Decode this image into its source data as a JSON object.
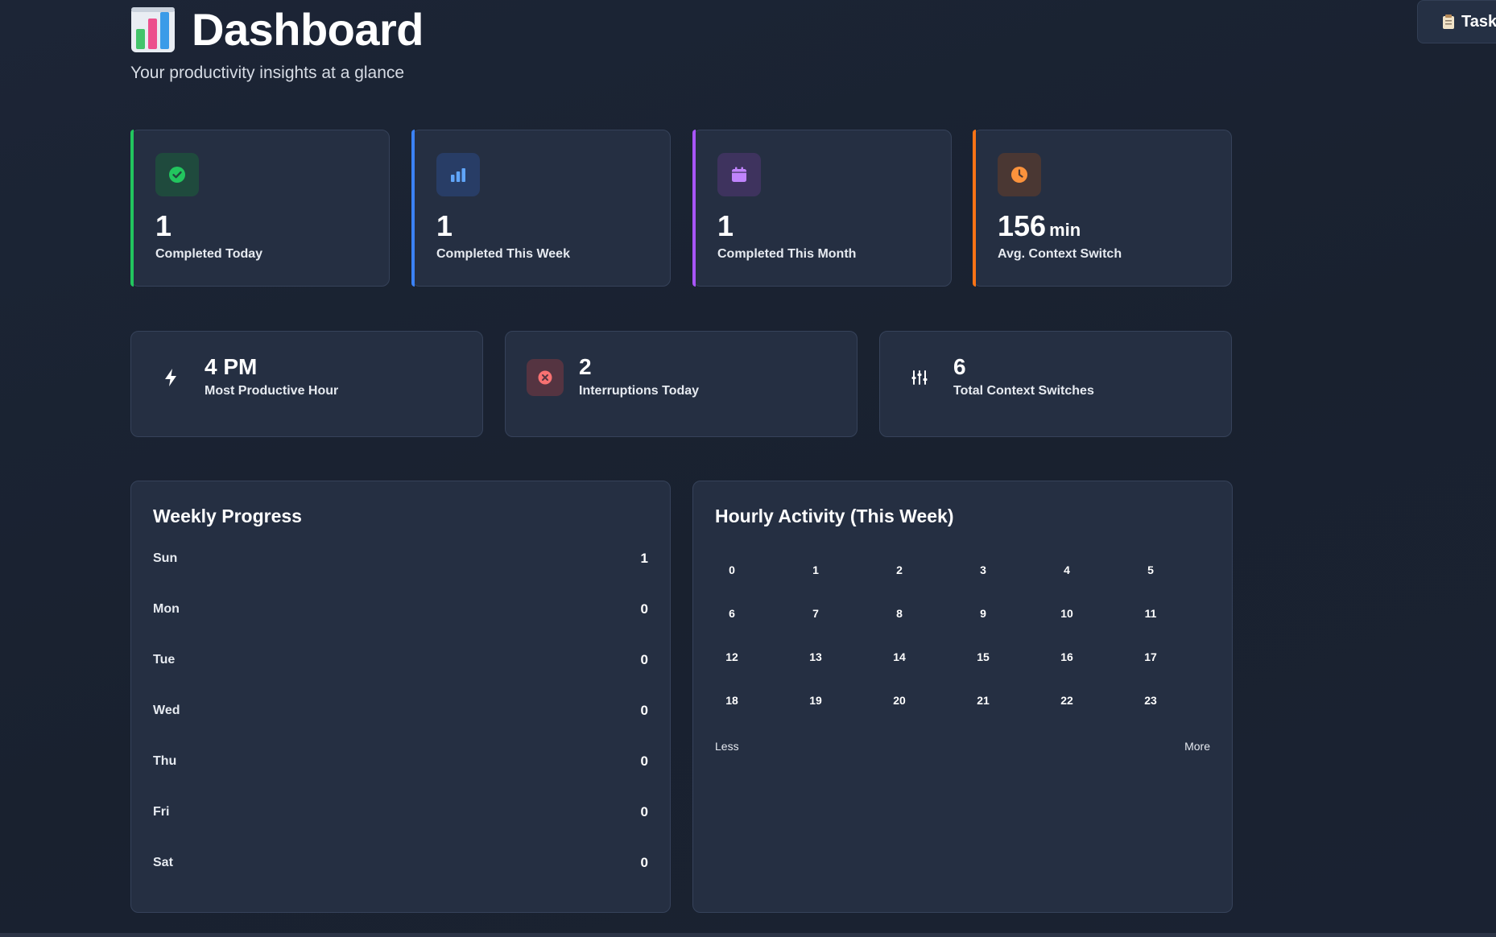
{
  "header": {
    "title": "Dashboard",
    "subtitle": "Your productivity insights at a glance",
    "icon": "bar-chart-emoji-icon"
  },
  "top_right": {
    "label": "Task",
    "icon": "clipboard-icon"
  },
  "stats": [
    {
      "value": "1",
      "unit": "",
      "label": "Completed Today",
      "icon": "check-circle-icon",
      "accent": "#22c55e",
      "icon_bg": "#1f4a3d",
      "icon_color": "#22c55e"
    },
    {
      "value": "1",
      "unit": "",
      "label": "Completed This Week",
      "icon": "bar-chart-icon",
      "accent": "#3b82f6",
      "icon_bg": "#283d66",
      "icon_color": "#60a5fa"
    },
    {
      "value": "1",
      "unit": "",
      "label": "Completed This Month",
      "icon": "calendar-icon",
      "accent": "#a855f7",
      "icon_bg": "#3e335e",
      "icon_color": "#c084fc"
    },
    {
      "value": "156",
      "unit": "min",
      "label": "Avg. Context Switch",
      "icon": "clock-icon",
      "accent": "#f97316",
      "icon_bg": "#4a3733",
      "icon_color": "#fb923c"
    }
  ],
  "mini_stats": [
    {
      "value": "4 PM",
      "label": "Most Productive Hour",
      "icon": "lightning-icon"
    },
    {
      "value": "2",
      "label": "Interruptions Today",
      "icon": "x-circle-icon"
    },
    {
      "value": "6",
      "label": "Total Context Switches",
      "icon": "sliders-icon"
    }
  ],
  "weekly": {
    "title": "Weekly Progress",
    "days": [
      {
        "day": "Sun",
        "count": "1"
      },
      {
        "day": "Mon",
        "count": "0"
      },
      {
        "day": "Tue",
        "count": "0"
      },
      {
        "day": "Wed",
        "count": "0"
      },
      {
        "day": "Thu",
        "count": "0"
      },
      {
        "day": "Fri",
        "count": "0"
      },
      {
        "day": "Sat",
        "count": "0"
      }
    ]
  },
  "hourly": {
    "title": "Hourly Activity (This Week)",
    "hours": [
      "0",
      "1",
      "2",
      "3",
      "4",
      "5",
      "6",
      "7",
      "8",
      "9",
      "10",
      "11",
      "12",
      "13",
      "14",
      "15",
      "16",
      "17",
      "18",
      "19",
      "20",
      "21",
      "22",
      "23"
    ],
    "legend_less": "Less",
    "legend_more": "More"
  },
  "colors": {
    "background": "#1a2233",
    "card": "#252f42",
    "border": "#36425a"
  }
}
